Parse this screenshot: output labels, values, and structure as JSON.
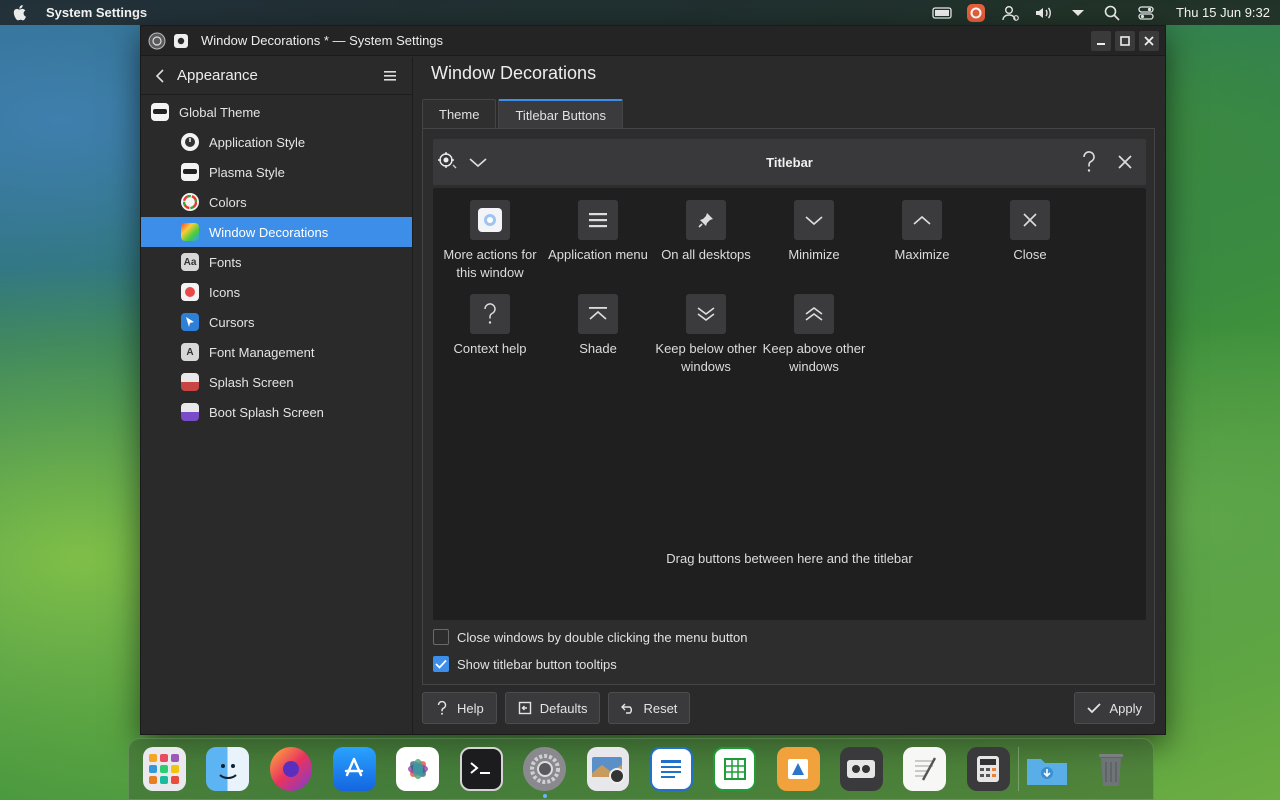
{
  "menubar": {
    "app_name": "System Settings",
    "clock": "Thu 15 Jun 9:32"
  },
  "window": {
    "title": "Window Decorations * — System Settings"
  },
  "sidebar": {
    "title": "Appearance",
    "items": [
      {
        "label": "Global Theme",
        "icon": "global-theme-icon",
        "level": "top"
      },
      {
        "label": "Application Style",
        "icon": "application-style-icon",
        "level": "sub"
      },
      {
        "label": "Plasma Style",
        "icon": "plasma-style-icon",
        "level": "sub"
      },
      {
        "label": "Colors",
        "icon": "colors-icon",
        "level": "sub"
      },
      {
        "label": "Window Decorations",
        "icon": "window-decorations-icon",
        "level": "sub",
        "active": true
      },
      {
        "label": "Fonts",
        "icon": "fonts-icon",
        "level": "sub"
      },
      {
        "label": "Icons",
        "icon": "icons-icon",
        "level": "sub"
      },
      {
        "label": "Cursors",
        "icon": "cursors-icon",
        "level": "sub"
      },
      {
        "label": "Font Management",
        "icon": "font-management-icon",
        "level": "sub"
      },
      {
        "label": "Splash Screen",
        "icon": "splash-screen-icon",
        "level": "sub"
      },
      {
        "label": "Boot Splash Screen",
        "icon": "boot-splash-screen-icon",
        "level": "sub"
      }
    ]
  },
  "main": {
    "page_title": "Window Decorations",
    "tabs": [
      {
        "label": "Theme",
        "active": false
      },
      {
        "label": "Titlebar Buttons",
        "active": true
      }
    ],
    "preview": {
      "title": "Titlebar"
    },
    "pool": [
      {
        "label": "More actions for this window",
        "icon": "more-actions-icon"
      },
      {
        "label": "Application menu",
        "icon": "application-menu-icon"
      },
      {
        "label": "On all desktops",
        "icon": "pin-icon"
      },
      {
        "label": "Minimize",
        "icon": "minimize-chevron-icon"
      },
      {
        "label": "Maximize",
        "icon": "maximize-chevron-icon"
      },
      {
        "label": "Close",
        "icon": "close-x-icon"
      },
      {
        "label": "Context help",
        "icon": "question-icon"
      },
      {
        "label": "Shade",
        "icon": "shade-icon"
      },
      {
        "label": "Keep below other windows",
        "icon": "keep-below-icon"
      },
      {
        "label": "Keep above other windows",
        "icon": "keep-above-icon"
      }
    ],
    "drag_hint": "Drag buttons between here and the titlebar",
    "options": [
      {
        "label": "Close windows by double clicking the menu button",
        "checked": false
      },
      {
        "label": "Show titlebar button tooltips",
        "checked": true
      }
    ]
  },
  "footer": {
    "help": "Help",
    "defaults": "Defaults",
    "reset": "Reset",
    "apply": "Apply"
  },
  "dock": {
    "items": [
      "launchpad-icon",
      "finder-icon",
      "firefox-icon",
      "app-store-icon",
      "photos-icon",
      "terminal-icon",
      "system-settings-icon",
      "screenshot-icon",
      "writer-icon",
      "calc-icon",
      "draw-icon",
      "tape-recorder-icon",
      "text-editor-icon",
      "calculator-icon",
      "downloads-folder-icon",
      "trash-icon"
    ],
    "active": "system-settings-icon"
  },
  "colors": {
    "accent": "#3d8ee8",
    "window_bg": "#2a2a2b",
    "pool_bg": "#1f1f20"
  }
}
